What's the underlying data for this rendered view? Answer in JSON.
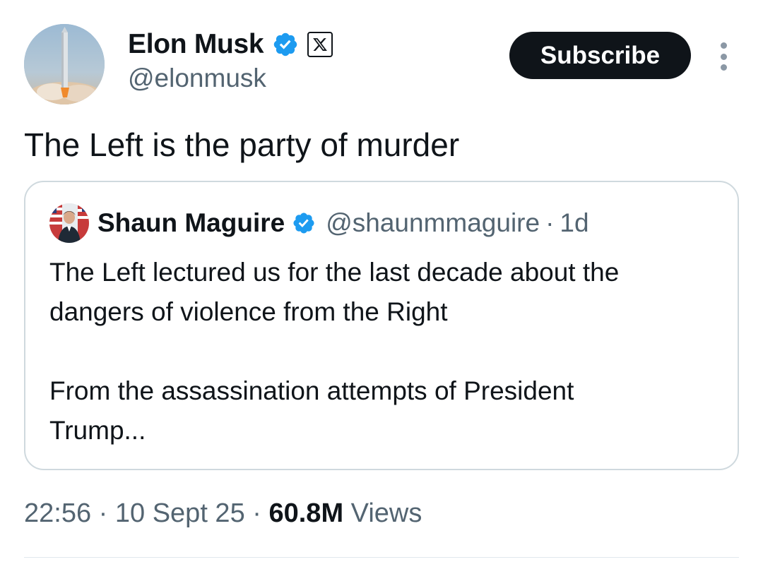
{
  "author": {
    "display_name": "Elon Musk",
    "handle": "@elonmusk",
    "verified_icon": "verified-badge-icon",
    "affiliation_icon": "x-logo-icon"
  },
  "actions": {
    "subscribe_label": "Subscribe",
    "more_icon": "more-vertical-icon"
  },
  "tweet": {
    "text": "The Left is the party of murder"
  },
  "quoted_tweet": {
    "display_name": "Shaun Maguire",
    "handle": "@shaunmmaguire",
    "separator": "·",
    "time": "1d",
    "paragraphs": [
      "The Left lectured us for the last decade about the",
      "dangers of violence from the Right",
      "",
      "From the assassination attempts of President",
      "Trump..."
    ]
  },
  "meta": {
    "time": "22:56",
    "separator": "·",
    "date": "10 Sept 25",
    "views_count": "60.8M",
    "views_label": "Views"
  },
  "colors": {
    "text": "#0f1419",
    "secondary": "#536471",
    "verified": "#1d9bf0",
    "border": "#cfd9de"
  }
}
